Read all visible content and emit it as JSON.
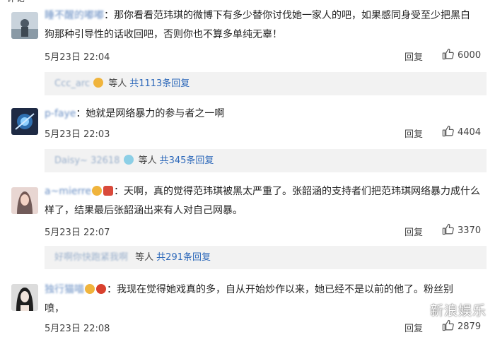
{
  "top_fragment": "评论",
  "comments": [
    {
      "username": "睡不醒的嘟嘟",
      "lines": [
        "那你看看范玮琪的微博下有多少替你讨伐她一家人的吧，如果感同身受至少把黑白",
        "狗那种引导性的话收回吧，否则你也不算多单纯无辜！"
      ],
      "time": "5月23日 22:04",
      "reply_label": "回复",
      "likes": "6000",
      "sub": {
        "names": "Ccc_arc",
        "deng": "等人",
        "total": "共1113条回复"
      }
    },
    {
      "username": "p-faye",
      "lines": [
        "她就是网络暴力的参与者之一啊"
      ],
      "time": "5月23日 22:03",
      "reply_label": "回复",
      "likes": "4404",
      "sub": {
        "names": "Daisy~ 32618",
        "deng": "等人",
        "total": "共345条回复"
      }
    },
    {
      "username": "a~mierre",
      "lines": [
        "天啊，真的觉得范玮琪被黑太严重了。张韶涵的支持者们把范玮琪网络暴力成什么",
        "样了，结果最后张韶涵出来有人对自己网暴。"
      ],
      "time": "5月23日 22:07",
      "reply_label": "回复",
      "likes": "3370",
      "sub": {
        "names": "好啊你快跑紧我啊",
        "deng": "等人",
        "total": "共291条回复"
      }
    },
    {
      "username": "独行猫喵",
      "lines": [
        "我现在觉得她戏真的多，自从开始炒作以来，她已经不是以前的他了。粉丝别",
        "喷，"
      ],
      "time": "5月23日 22:08",
      "reply_label": "回复",
      "likes": "2879"
    }
  ],
  "watermark": "新浪娱乐",
  "colors": {
    "link": "#2e69ba",
    "subbg": "#f2f2f2"
  }
}
